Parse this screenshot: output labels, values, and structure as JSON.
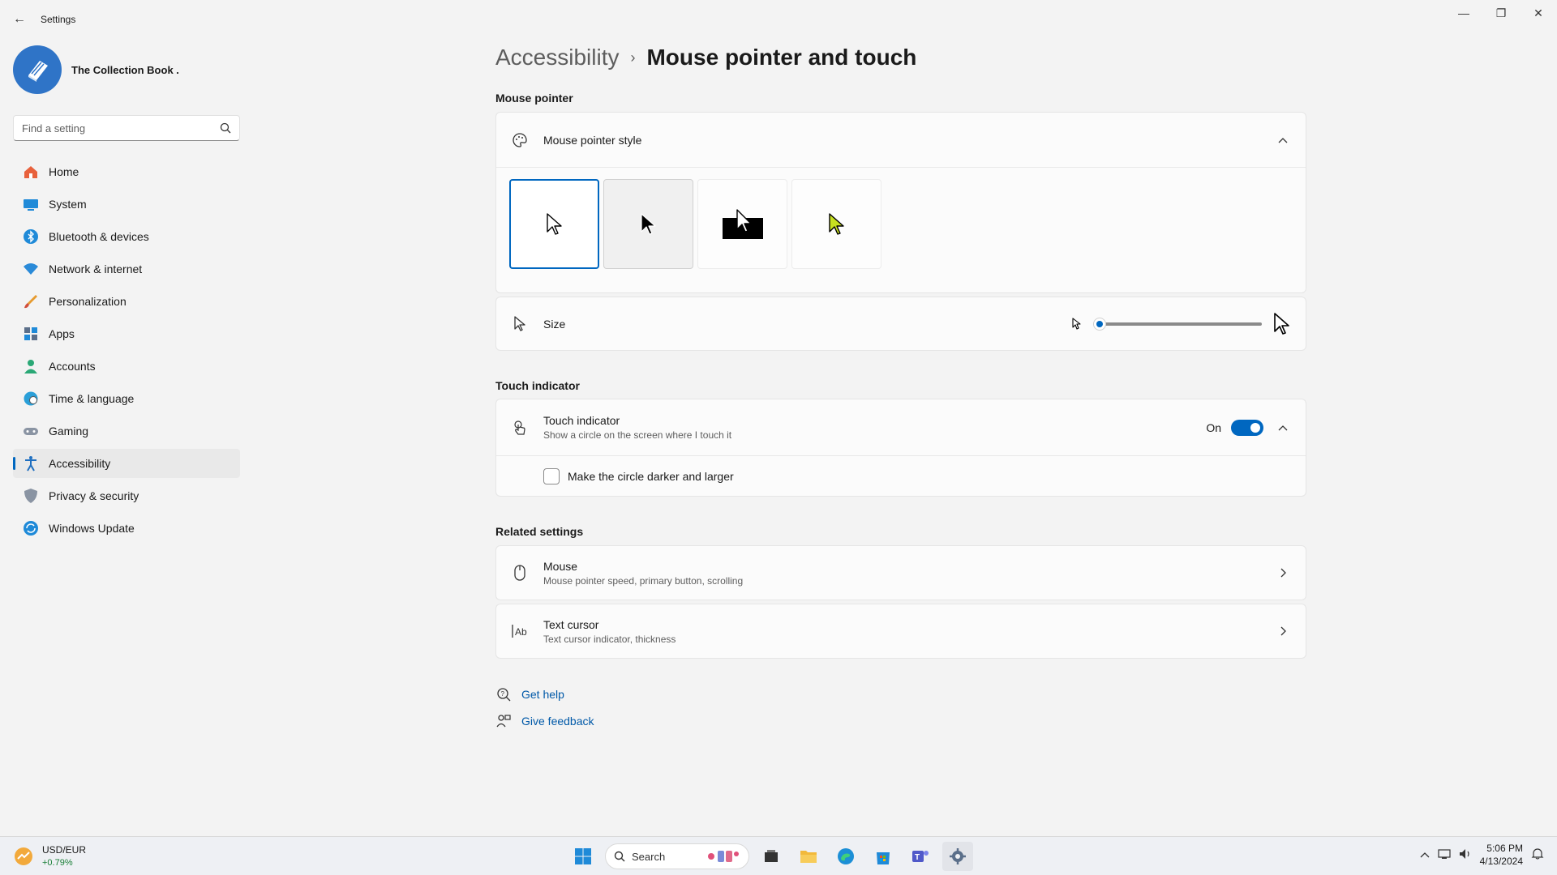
{
  "window": {
    "title": "Settings",
    "back_glyph": "←",
    "minimize_glyph": "—",
    "maximize_glyph": "❐",
    "close_glyph": "✕"
  },
  "profile": {
    "name": "The Collection Book ."
  },
  "search": {
    "placeholder": "Find a setting"
  },
  "nav": [
    {
      "label": "Home",
      "icon": "home-icon"
    },
    {
      "label": "System",
      "icon": "system-icon"
    },
    {
      "label": "Bluetooth & devices",
      "icon": "bluetooth-icon"
    },
    {
      "label": "Network & internet",
      "icon": "wifi-icon"
    },
    {
      "label": "Personalization",
      "icon": "brush-icon"
    },
    {
      "label": "Apps",
      "icon": "apps-icon"
    },
    {
      "label": "Accounts",
      "icon": "account-icon"
    },
    {
      "label": "Time & language",
      "icon": "globe-icon"
    },
    {
      "label": "Gaming",
      "icon": "gamepad-icon"
    },
    {
      "label": "Accessibility",
      "icon": "accessibility-icon",
      "active": true
    },
    {
      "label": "Privacy & security",
      "icon": "shield-icon"
    },
    {
      "label": "Windows Update",
      "icon": "update-icon"
    }
  ],
  "breadcrumb": {
    "parent": "Accessibility",
    "separator": "›",
    "current": "Mouse pointer and touch"
  },
  "mouse_pointer": {
    "section_title": "Mouse pointer",
    "style_label": "Mouse pointer style",
    "styles": [
      "white",
      "black",
      "inverted",
      "custom"
    ],
    "selected_style": "white",
    "size_label": "Size",
    "size_value": 1,
    "size_min": 1,
    "size_max": 15
  },
  "touch": {
    "section_title": "Touch indicator",
    "title": "Touch indicator",
    "subtitle": "Show a circle on the screen where I touch it",
    "toggle_state": "On",
    "checkbox_label": "Make the circle darker and larger",
    "checkbox_checked": false
  },
  "related": {
    "section_title": "Related settings",
    "items": [
      {
        "title": "Mouse",
        "subtitle": "Mouse pointer speed, primary button, scrolling",
        "icon": "mouse-icon"
      },
      {
        "title": "Text cursor",
        "subtitle": "Text cursor indicator, thickness",
        "icon": "text-cursor-icon"
      }
    ]
  },
  "help": {
    "get_help": "Get help",
    "give_feedback": "Give feedback"
  },
  "taskbar": {
    "widget_title": "USD/EUR",
    "widget_change": "+0.79%",
    "search_label": "Search",
    "time": "5:06 PM",
    "date": "4/13/2024"
  },
  "colors": {
    "accent": "#0067c0",
    "yellow_pointer": "#c7e020"
  }
}
